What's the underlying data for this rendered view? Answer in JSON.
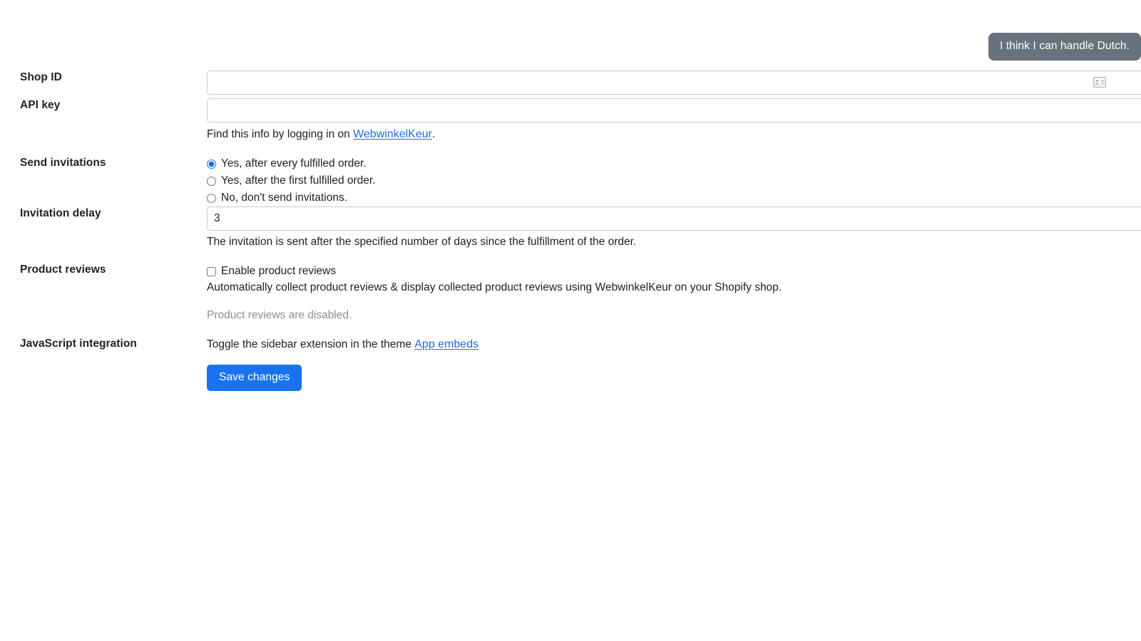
{
  "toast": {
    "message": "I think I can handle Dutch.",
    "background": "#68727d",
    "text_color": "#ffffff"
  },
  "form": {
    "shop_id": {
      "label": "Shop ID",
      "value": "",
      "placeholder": "",
      "autofill_icon": "contact-card-icon"
    },
    "api_key": {
      "label": "API key",
      "value": "",
      "placeholder": ""
    },
    "api_key_help": {
      "prefix": "Find this info by logging in on ",
      "link_text": "WebwinkelKeur",
      "suffix": "."
    },
    "send_invitations": {
      "label": "Send invitations",
      "selected_index": 0,
      "options": [
        {
          "label": "Yes, after every fulfilled order.",
          "checked": true
        },
        {
          "label": "Yes, after the first fulfilled order.",
          "checked": false
        },
        {
          "label": "No, don't send invitations.",
          "checked": false
        }
      ]
    },
    "invitation_delay": {
      "label": "Invitation delay",
      "value": "3",
      "placeholder": "",
      "help": "The invitation is sent after the specified number of days since the fulfillment of the order."
    },
    "product_reviews": {
      "label": "Product reviews",
      "checkbox_label": "Enable product reviews",
      "checked": false,
      "description": "Automatically collect product reviews & display collected product reviews using WebwinkelKeur on your Shopify shop.",
      "status": "Product reviews are disabled."
    },
    "javascript_integration": {
      "label": "JavaScript integration",
      "text_prefix": "Toggle the sidebar extension in the theme ",
      "link_text": "App embeds"
    },
    "save": {
      "label": "Save changes",
      "background": "#1773f0"
    }
  },
  "colors": {
    "link": "#1a6fe0",
    "label": "#1f2123",
    "body": "#202223",
    "muted": "#8a9096",
    "input_border": "#c9cccf"
  }
}
